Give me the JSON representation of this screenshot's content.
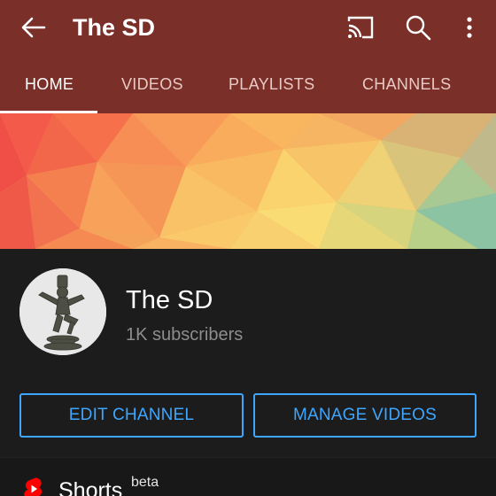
{
  "appbar": {
    "title": "The SD",
    "icons": [
      "back-arrow-icon",
      "cast-icon",
      "search-icon",
      "more-vert-icon"
    ]
  },
  "tabs": [
    {
      "label": "HOME",
      "active": true
    },
    {
      "label": "VIDEOS",
      "active": false
    },
    {
      "label": "PLAYLISTS",
      "active": false
    },
    {
      "label": "CHANNELS",
      "active": false
    }
  ],
  "channel": {
    "name": "The SD",
    "subscribers": "1K subscribers",
    "edit_label": "EDIT CHANNEL",
    "manage_label": "MANAGE VIDEOS"
  },
  "shorts": {
    "label": "Shorts",
    "badge": "beta"
  },
  "colors": {
    "header": "#7a2f28",
    "background": "#1c1c1c",
    "accent_blue": "#3ea6ff",
    "shorts_red": "#ff0000"
  }
}
